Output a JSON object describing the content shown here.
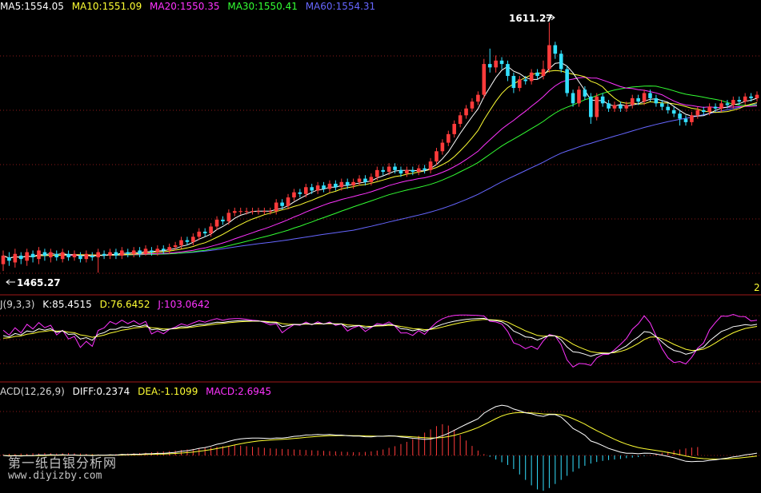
{
  "colors": {
    "up": "#ff3b3b",
    "down": "#33e0ff",
    "ma5": "#ffffff",
    "ma10": "#ffff33",
    "ma20": "#ff33ff",
    "ma30": "#33ff33",
    "ma60": "#6666ff",
    "k": "#ffffff",
    "d": "#ffff33",
    "j": "#ff33ff",
    "grid": "#8b1a1a"
  },
  "price_panel": {
    "legend": [
      {
        "text": "MA5:1554.05",
        "color": "#ffffff"
      },
      {
        "text": "MA10:1551.09",
        "color": "#ffff33"
      },
      {
        "text": "MA20:1550.35",
        "color": "#ff33ff"
      },
      {
        "text": "MA30:1550.41",
        "color": "#33ff33"
      },
      {
        "text": "MA60:1554.31",
        "color": "#6666ff"
      }
    ],
    "high_label": "1611.27",
    "low_label": "1465.27",
    "corner_label": "2"
  },
  "kdj_panel": {
    "legend": [
      {
        "text": "J(9,3,3)",
        "color": "#d8d8d8"
      },
      {
        "text": "K:85.4515",
        "color": "#ffffff"
      },
      {
        "text": "D:76.6452",
        "color": "#ffff33"
      },
      {
        "text": "J:103.0642",
        "color": "#ff33ff"
      }
    ]
  },
  "macd_panel": {
    "legend": [
      {
        "text": "ACD(12,26,9)",
        "color": "#d8d8d8"
      },
      {
        "text": "DIFF:0.2374",
        "color": "#ffffff"
      },
      {
        "text": "DEA:-1.1099",
        "color": "#ffff33"
      },
      {
        "text": "MACD:2.6945",
        "color": "#ff33ff"
      }
    ]
  },
  "watermark": {
    "cn": "第一纸白银分析网",
    "url": "www.diyizby.com"
  },
  "chart_data": {
    "type": "candlestick",
    "y_extremes": {
      "high": 1611.27,
      "low": 1465.27
    },
    "candles": [
      [
        1470,
        1475,
        1466,
        1478
      ],
      [
        1474,
        1472,
        1469,
        1477
      ],
      [
        1471,
        1476,
        1468,
        1479
      ],
      [
        1475,
        1473,
        1470,
        1477
      ],
      [
        1472,
        1477,
        1469,
        1479
      ],
      [
        1476,
        1474,
        1471,
        1478
      ],
      [
        1473,
        1478,
        1470,
        1480
      ],
      [
        1477,
        1475,
        1472,
        1479
      ],
      [
        1474,
        1477,
        1471,
        1479
      ],
      [
        1476,
        1474,
        1472,
        1478
      ],
      [
        1473,
        1477,
        1471,
        1479
      ],
      [
        1476,
        1474,
        1472,
        1478
      ],
      [
        1474,
        1476,
        1472,
        1478
      ],
      [
        1475,
        1473,
        1471,
        1477
      ],
      [
        1473,
        1476,
        1471,
        1478
      ],
      [
        1475,
        1474,
        1472,
        1477
      ],
      [
        1474,
        1477,
        1465,
        1479
      ],
      [
        1476,
        1475,
        1473,
        1478
      ],
      [
        1475,
        1477,
        1473,
        1479
      ],
      [
        1477,
        1475,
        1473,
        1479
      ],
      [
        1475,
        1478,
        1473,
        1480
      ],
      [
        1477,
        1476,
        1474,
        1479
      ],
      [
        1476,
        1478,
        1474,
        1480
      ],
      [
        1478,
        1476,
        1474,
        1480
      ],
      [
        1476,
        1479,
        1475,
        1481
      ],
      [
        1478,
        1477,
        1475,
        1480
      ],
      [
        1477,
        1479,
        1475,
        1481
      ],
      [
        1479,
        1478,
        1476,
        1481
      ],
      [
        1478,
        1480,
        1476,
        1482
      ],
      [
        1480,
        1481,
        1478,
        1483
      ],
      [
        1481,
        1484,
        1479,
        1486
      ],
      [
        1484,
        1483,
        1481,
        1486
      ],
      [
        1483,
        1486,
        1481,
        1488
      ],
      [
        1486,
        1489,
        1484,
        1491
      ],
      [
        1489,
        1488,
        1486,
        1491
      ],
      [
        1488,
        1492,
        1486,
        1494
      ],
      [
        1492,
        1496,
        1490,
        1498
      ],
      [
        1496,
        1495,
        1493,
        1498
      ],
      [
        1495,
        1500,
        1493,
        1502
      ],
      [
        1500,
        1501,
        1498,
        1503
      ],
      [
        1501,
        1501,
        1499,
        1503
      ],
      [
        1501,
        1501,
        1499,
        1503
      ],
      [
        1501,
        1501,
        1499,
        1503
      ],
      [
        1501,
        1501,
        1499,
        1503
      ],
      [
        1501,
        1501,
        1499,
        1503
      ],
      [
        1501,
        1501,
        1499,
        1503
      ],
      [
        1501,
        1506,
        1499,
        1508
      ],
      [
        1506,
        1504,
        1502,
        1508
      ],
      [
        1504,
        1509,
        1502,
        1511
      ],
      [
        1509,
        1512,
        1507,
        1514
      ],
      [
        1512,
        1511,
        1509,
        1514
      ],
      [
        1511,
        1515,
        1509,
        1517
      ],
      [
        1515,
        1513,
        1511,
        1517
      ],
      [
        1513,
        1516,
        1511,
        1518
      ],
      [
        1516,
        1514,
        1512,
        1518
      ],
      [
        1514,
        1517,
        1512,
        1519
      ],
      [
        1517,
        1515,
        1513,
        1519
      ],
      [
        1515,
        1518,
        1513,
        1520
      ],
      [
        1518,
        1516,
        1514,
        1520
      ],
      [
        1516,
        1518,
        1514,
        1520
      ],
      [
        1518,
        1520,
        1516,
        1522
      ],
      [
        1520,
        1518,
        1516,
        1522
      ],
      [
        1518,
        1521,
        1516,
        1523
      ],
      [
        1521,
        1525,
        1519,
        1527
      ],
      [
        1525,
        1524,
        1522,
        1527
      ],
      [
        1524,
        1527,
        1522,
        1529
      ],
      [
        1527,
        1525,
        1523,
        1529
      ],
      [
        1525,
        1523,
        1521,
        1527
      ],
      [
        1523,
        1525,
        1521,
        1527
      ],
      [
        1525,
        1524,
        1522,
        1527
      ],
      [
        1524,
        1526,
        1522,
        1528
      ],
      [
        1526,
        1525,
        1523,
        1528
      ],
      [
        1525,
        1530,
        1523,
        1532
      ],
      [
        1530,
        1536,
        1528,
        1538
      ],
      [
        1536,
        1541,
        1534,
        1543
      ],
      [
        1541,
        1546,
        1539,
        1548
      ],
      [
        1546,
        1552,
        1544,
        1554
      ],
      [
        1552,
        1557,
        1550,
        1559
      ],
      [
        1557,
        1561,
        1555,
        1563
      ],
      [
        1561,
        1565,
        1559,
        1567
      ],
      [
        1565,
        1569,
        1563,
        1571
      ],
      [
        1569,
        1587,
        1567,
        1590
      ],
      [
        1587,
        1585,
        1582,
        1596
      ],
      [
        1585,
        1589,
        1582,
        1592
      ],
      [
        1589,
        1587,
        1584,
        1591
      ],
      [
        1587,
        1580,
        1577,
        1589
      ],
      [
        1580,
        1573,
        1570,
        1582
      ],
      [
        1573,
        1578,
        1571,
        1580
      ],
      [
        1578,
        1577,
        1575,
        1580
      ],
      [
        1577,
        1582,
        1575,
        1584
      ],
      [
        1582,
        1580,
        1578,
        1584
      ],
      [
        1580,
        1584,
        1578,
        1589
      ],
      [
        1584,
        1598,
        1582,
        1611.27
      ],
      [
        1598,
        1593,
        1590,
        1600
      ],
      [
        1593,
        1584,
        1582,
        1595
      ],
      [
        1584,
        1570,
        1568,
        1586
      ],
      [
        1570,
        1564,
        1562,
        1572
      ],
      [
        1564,
        1572,
        1562,
        1574
      ],
      [
        1572,
        1568,
        1566,
        1574
      ],
      [
        1568,
        1556,
        1552,
        1570
      ],
      [
        1556,
        1568,
        1554,
        1570
      ],
      [
        1568,
        1564,
        1562,
        1570
      ],
      [
        1564,
        1561,
        1559,
        1566
      ],
      [
        1561,
        1563,
        1559,
        1565
      ],
      [
        1563,
        1561,
        1559,
        1565
      ],
      [
        1561,
        1563,
        1559,
        1565
      ],
      [
        1563,
        1567,
        1561,
        1569
      ],
      [
        1567,
        1565,
        1563,
        1569
      ],
      [
        1565,
        1570,
        1563,
        1572
      ],
      [
        1570,
        1567,
        1565,
        1572
      ],
      [
        1567,
        1564,
        1562,
        1569
      ],
      [
        1564,
        1562,
        1560,
        1566
      ],
      [
        1562,
        1560,
        1558,
        1564
      ],
      [
        1560,
        1558,
        1556,
        1562
      ],
      [
        1558,
        1555,
        1551,
        1560
      ],
      [
        1555,
        1553,
        1551,
        1557
      ],
      [
        1553,
        1557,
        1551,
        1559
      ],
      [
        1557,
        1560,
        1555,
        1562
      ],
      [
        1560,
        1559,
        1557,
        1562
      ],
      [
        1559,
        1562,
        1557,
        1564
      ],
      [
        1562,
        1561,
        1559,
        1564
      ],
      [
        1561,
        1564,
        1559,
        1566
      ],
      [
        1564,
        1563,
        1561,
        1566
      ],
      [
        1563,
        1566,
        1561,
        1568
      ],
      [
        1566,
        1565,
        1563,
        1568
      ],
      [
        1565,
        1568,
        1563,
        1570
      ],
      [
        1568,
        1567,
        1565,
        1570
      ],
      [
        1567,
        1569,
        1565,
        1571
      ]
    ],
    "macd_hist": [
      0.4,
      0.6,
      0.5,
      0.7,
      0.6,
      0.8,
      0.7,
      0.9,
      0.8,
      0.7,
      0.8,
      0.9,
      0.8,
      0.7,
      0.6,
      0.5,
      0.4,
      0.3,
      0.4,
      0.5,
      0.6,
      0.7,
      0.8,
      0.9,
      1.0,
      1.2,
      1.4,
      1.5,
      1.6,
      1.8,
      2.0,
      2.2,
      2.4,
      2.6,
      2.8,
      3.0,
      3.2,
      3.4,
      3.6,
      3.8,
      3.6,
      3.4,
      3.2,
      3.0,
      2.8,
      2.6,
      2.5,
      2.4,
      2.3,
      2.2,
      2.1,
      2.0,
      1.9,
      1.8,
      1.7,
      1.6,
      1.5,
      1.4,
      1.3,
      1.2,
      1.2,
      1.3,
      1.5,
      1.8,
      2.2,
      2.8,
      3.4,
      4.2,
      5.0,
      6.0,
      7.2,
      8.4,
      9.6,
      10.8,
      11.5,
      11.0,
      9.5,
      7.5,
      5.5,
      3.5,
      1.8,
      0.5,
      -0.5,
      -1.5,
      -2.5,
      -3.5,
      -5.0,
      -7.0,
      -9.0,
      -11.0,
      -12.5,
      -13.0,
      -12.0,
      -10.5,
      -9.0,
      -7.5,
      -6.0,
      -4.8,
      -3.8,
      -3.0,
      -2.4,
      -2.0,
      -1.7,
      -1.5,
      -1.3,
      -1.0,
      -0.8,
      -0.6,
      -0.3,
      0.2,
      0.6,
      1.0,
      1.4,
      1.8,
      2.2,
      2.6,
      2.9,
      3.1
    ]
  }
}
